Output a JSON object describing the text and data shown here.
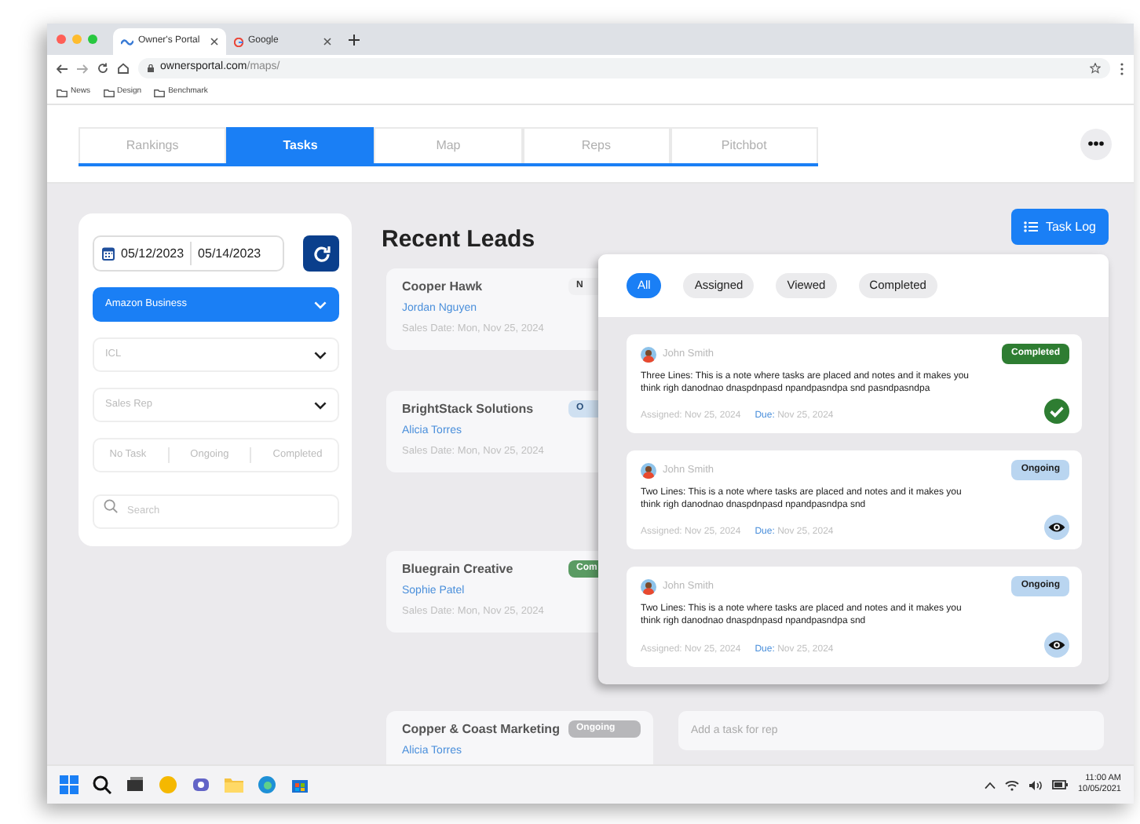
{
  "browser": {
    "tabs": [
      {
        "title": "Owner's Portal",
        "selected": true
      },
      {
        "title": "Google",
        "selected": false
      }
    ],
    "url_host": "ownersportal.com",
    "url_path": "/maps/",
    "bookmarks": [
      "News",
      "Design",
      "Benchmark"
    ]
  },
  "nav_tabs": [
    {
      "label": "Rankings",
      "selected": false
    },
    {
      "label": "Tasks",
      "selected": true
    },
    {
      "label": "Map",
      "selected": false
    },
    {
      "label": "Reps",
      "selected": false
    },
    {
      "label": "Pitchbot",
      "selected": false
    }
  ],
  "filters": {
    "date_from": "05/12/2023",
    "date_to": "05/14/2023",
    "account": "Amazon Business",
    "icl_placeholder": "ICL",
    "rep_placeholder": "Sales Rep",
    "status_options": [
      {
        "label": "No Task",
        "selected": false
      },
      {
        "label": "Ongoing",
        "selected": false
      },
      {
        "label": "Completed",
        "selected": false
      }
    ],
    "search_placeholder": "Search"
  },
  "leads_title": "Recent Leads",
  "task_log_button": "Task Log",
  "leads": [
    {
      "company": "Cooper Hawk",
      "rep": "Jordan Nguyen",
      "sales_date": "Sales Date: Mon, Nov 25, 2024",
      "status": "N",
      "kind": "none"
    },
    {
      "company": "BrightStack Solutions",
      "rep": "Alicia Torres",
      "sales_date": "Sales Date: Mon, Nov 25, 2024",
      "status": "O",
      "kind": "ongoing"
    },
    {
      "company": "Bluegrain Creative",
      "rep": "Sophie Patel",
      "sales_date": "Sales Date: Mon, Nov 25, 2024",
      "status": "Com",
      "kind": "completed"
    },
    {
      "company": "Copper & Coast Marketing",
      "rep": "Alicia Torres",
      "status": "Ongoing",
      "kind": "inactive"
    }
  ],
  "task_log": {
    "filters": [
      {
        "label": "All",
        "selected": true
      },
      {
        "label": "Assigned",
        "selected": false
      },
      {
        "label": "Viewed",
        "selected": false
      },
      {
        "label": "Completed",
        "selected": false
      }
    ],
    "tasks": [
      {
        "author": "John Smith",
        "status": "Completed",
        "kind": "completed",
        "note": "Three Lines: This is a note where tasks are placed and notes and it makes you think righ danodnao dnaspdnpasd npandpasndpa snd pasndpasndpa",
        "assigned": "Assigned: Nov 25, 2024",
        "due_label": "Due:",
        "due": "Nov 25, 2024"
      },
      {
        "author": "John Smith",
        "status": "Ongoing",
        "kind": "ongoing",
        "note": "Two Lines: This is a note where tasks are placed and notes and it makes you think righ danodnao dnaspdnpasd npandpasndpa snd",
        "assigned": "Assigned: Nov 25, 2024",
        "due_label": "Due:",
        "due": "Nov 25, 2024"
      },
      {
        "author": "John Smith",
        "status": "Ongoing",
        "kind": "ongoing",
        "note": "Two Lines: This is a note where tasks are placed and notes and it makes you think righ danodnao dnaspdnpasd npandpasndpa snd",
        "assigned": "Assigned: Nov 25, 2024",
        "due_label": "Due:",
        "due": "Nov 25, 2024"
      }
    ]
  },
  "add_task_placeholder": "Add a task for rep",
  "taskbar": {
    "time": "11:00 AM",
    "date": "10/05/2021"
  }
}
